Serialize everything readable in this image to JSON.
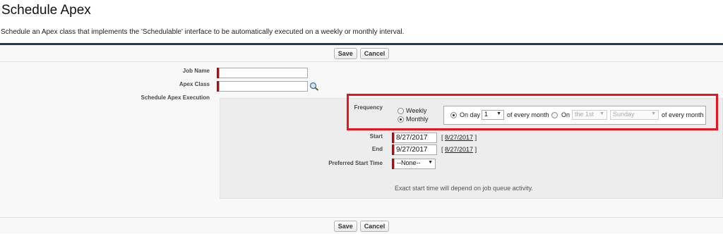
{
  "header": {
    "title": "Schedule Apex",
    "description": "Schedule an Apex class that implements the 'Schedulable' interface to be automatically executed on a weekly or monthly interval."
  },
  "buttons": {
    "save_label": "Save",
    "cancel_label": "Cancel"
  },
  "form": {
    "job_name_label": "Job Name",
    "job_name_value": "",
    "apex_class_label": "Apex Class",
    "apex_class_value": "",
    "schedule_label": "Schedule Apex Execution",
    "frequency_label": "Frequency",
    "frequency_options": [
      "Weekly",
      "Monthly"
    ],
    "frequency_selected": "Monthly",
    "on_day_label": "On day",
    "on_day_value": "1",
    "of_every_month": "of every month",
    "on_label": "On",
    "ordinal_value": "the 1st",
    "weekday_value": "Sunday",
    "start_label": "Start",
    "start_value": "8/27/2017",
    "start_link": "8/27/2017",
    "end_label": "End",
    "end_value": "9/27/2017",
    "end_link": "8/27/2017",
    "pst_label": "Preferred Start Time",
    "pst_value": "--None--",
    "note": "Exact start time will depend on job queue activity."
  },
  "colors": {
    "accent_border": "#1f3b55",
    "required": "#cc0000",
    "highlight": "#e8141e"
  }
}
